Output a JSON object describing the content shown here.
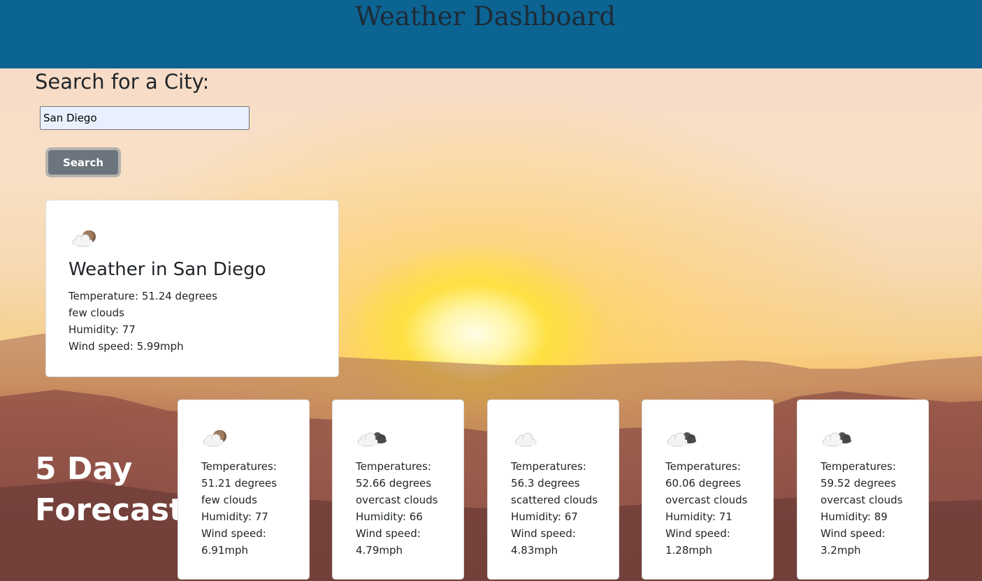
{
  "header": {
    "title": "Weather Dashboard"
  },
  "search": {
    "title": "Search for a City:",
    "input_value": "San Diego",
    "button_label": "Search"
  },
  "current": {
    "icon": "partly-cloudy-night-icon",
    "title": "Weather in San Diego",
    "temperature": "Temperature: 51.24 degrees",
    "description": "few clouds",
    "humidity": "Humidity: 77",
    "wind": "Wind speed: 5.99mph"
  },
  "forecast": {
    "title_line1": "5 Day",
    "title_line2": "Forecast",
    "days": [
      {
        "icon": "partly-cloudy-night-icon",
        "temp_label": "Temperatures:",
        "temp": "51.21 degrees",
        "description": "few clouds",
        "humidity": "Humidity: 77",
        "wind_label": "Wind speed:",
        "wind": "6.91mph"
      },
      {
        "icon": "overcast-clouds-icon",
        "temp_label": "Temperatures:",
        "temp": "52.66 degrees",
        "description": "overcast clouds",
        "humidity": "Humidity: 66",
        "wind_label": "Wind speed:",
        "wind": "4.79mph"
      },
      {
        "icon": "scattered-clouds-icon",
        "temp_label": "Temperatures:",
        "temp": "56.3 degrees",
        "description": "scattered clouds",
        "humidity": "Humidity: 67",
        "wind_label": "Wind speed:",
        "wind": "4.83mph"
      },
      {
        "icon": "overcast-clouds-icon",
        "temp_label": "Temperatures:",
        "temp": "60.06 degrees",
        "description": "overcast clouds",
        "humidity": "Humidity: 71",
        "wind_label": "Wind speed:",
        "wind": "1.28mph"
      },
      {
        "icon": "overcast-clouds-icon",
        "temp_label": "Temperatures:",
        "temp": "59.52 degrees",
        "description": "overcast clouds",
        "humidity": "Humidity: 89",
        "wind_label": "Wind speed:",
        "wind": "3.2mph"
      }
    ]
  },
  "colors": {
    "header_bg": "#0c6493",
    "button_bg": "#6c757d",
    "input_bg": "#e8f0fe"
  }
}
